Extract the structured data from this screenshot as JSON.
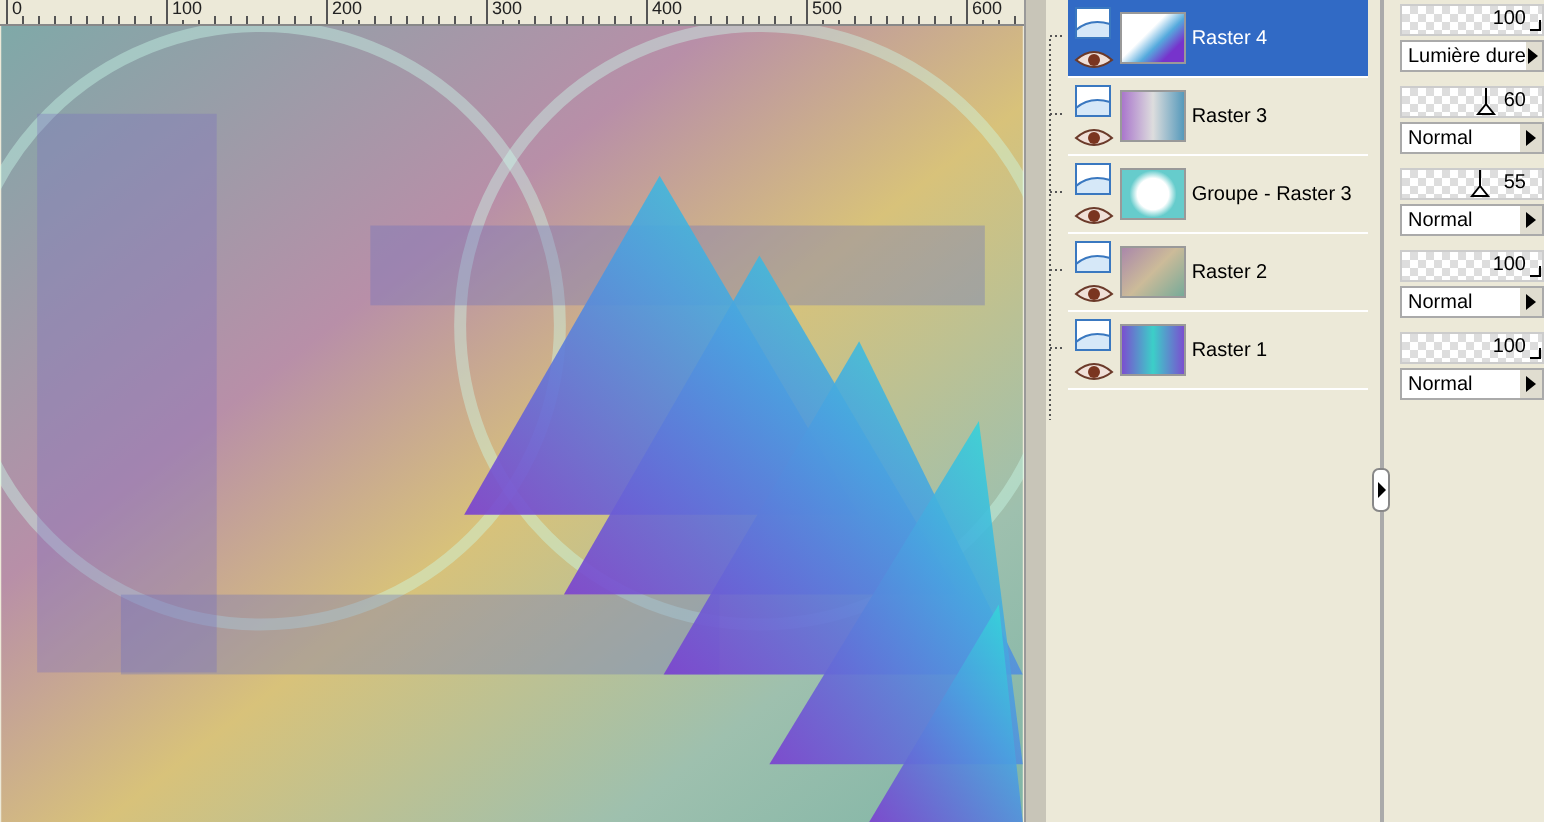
{
  "ruler": {
    "labels": [
      "0",
      "100",
      "200",
      "300",
      "400",
      "500",
      "600"
    ]
  },
  "layers": [
    {
      "name": "Raster 4",
      "selected": true,
      "opacity": "100",
      "level": 1,
      "blend": "Lumière dure"
    },
    {
      "name": "Raster 3",
      "selected": false,
      "opacity": "60",
      "level": 0.6,
      "blend": "Normal"
    },
    {
      "name": "Groupe - Raster 3",
      "selected": false,
      "opacity": "55",
      "level": 0.55,
      "blend": "Normal"
    },
    {
      "name": "Raster 2",
      "selected": false,
      "opacity": "100",
      "level": 1,
      "blend": "Normal"
    },
    {
      "name": "Raster 1",
      "selected": false,
      "opacity": "100",
      "level": 1,
      "blend": "Normal"
    }
  ]
}
